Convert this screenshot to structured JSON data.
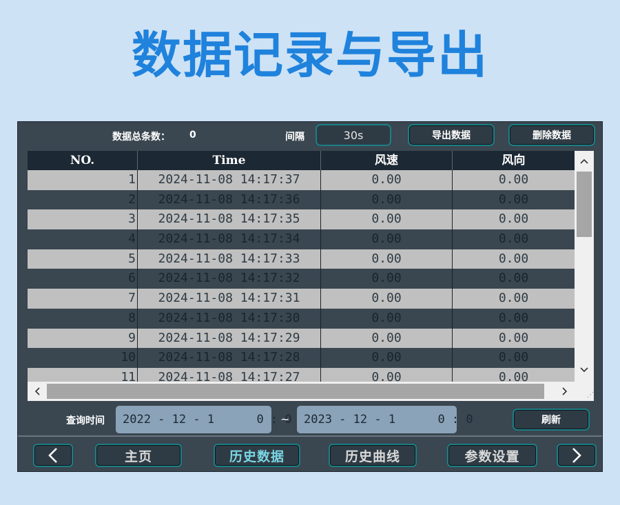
{
  "headline": "数据记录与导出",
  "toolbar": {
    "count_label": "数据总条数：",
    "count_value": "0",
    "interval_label": "间隔",
    "interval_value": "30s",
    "export_label": "导出数据",
    "delete_label": "删除数据"
  },
  "table": {
    "headers": [
      "NO.",
      "Time",
      "风速",
      "风向"
    ],
    "rows": [
      [
        "1",
        "2024-11-08 14:17:37",
        "0.00",
        "0.00"
      ],
      [
        "2",
        "2024-11-08 14:17:36",
        "0.00",
        "0.00"
      ],
      [
        "3",
        "2024-11-08 14:17:35",
        "0.00",
        "0.00"
      ],
      [
        "4",
        "2024-11-08 14:17:34",
        "0.00",
        "0.00"
      ],
      [
        "5",
        "2024-11-08 14:17:33",
        "0.00",
        "0.00"
      ],
      [
        "6",
        "2024-11-08 14:17:32",
        "0.00",
        "0.00"
      ],
      [
        "7",
        "2024-11-08 14:17:31",
        "0.00",
        "0.00"
      ],
      [
        "8",
        "2024-11-08 14:17:30",
        "0.00",
        "0.00"
      ],
      [
        "9",
        "2024-11-08 14:17:29",
        "0.00",
        "0.00"
      ],
      [
        "10",
        "2024-11-08 14:17:28",
        "0.00",
        "0.00"
      ],
      [
        "11",
        "2024-11-08 14:17:27",
        "0.00",
        "0.00"
      ]
    ]
  },
  "query": {
    "label": "查询时间",
    "start": "2022 - 12 - 1      0 : 0",
    "separator": "~",
    "end": "2023 - 12 - 1      0 : 0",
    "refresh_label": "刷新"
  },
  "nav": {
    "home_label": "主页",
    "history_data_label": "历史数据",
    "history_curve_label": "历史曲线",
    "settings_label": "参数设置",
    "active": "history_data"
  },
  "icons": {
    "prev": "chevron-left-icon",
    "next": "chevron-right-icon",
    "scroll_up": "caret-up-icon",
    "scroll_down": "caret-down-icon",
    "scroll_left": "caret-left-icon",
    "scroll_right": "caret-right-icon"
  },
  "colors": {
    "headline": "#1f82dc",
    "panel": "#3a4650",
    "accent_border": "#1b7f86",
    "row_light": "#c0c0c0",
    "row_dark": "#3a4650",
    "header": "#1c2833"
  }
}
